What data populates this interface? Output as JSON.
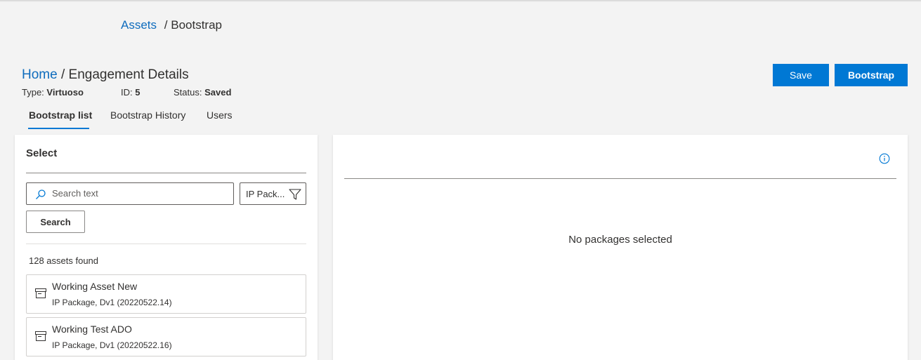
{
  "breadcrumb_top": {
    "link": "Assets",
    "separator": "/",
    "current": "Bootstrap"
  },
  "page": {
    "home_link": "Home",
    "title_rest": "/ Engagement Details"
  },
  "meta": {
    "type_label": "Type:",
    "type_value": "Virtuoso",
    "id_label": "ID:",
    "id_value": "5",
    "status_label": "Status:",
    "status_value": "Saved"
  },
  "actions": {
    "save_label": "Save",
    "bootstrap_label": "Bootstrap"
  },
  "tabs": [
    {
      "label": "Bootstrap list",
      "active": true
    },
    {
      "label": "Bootstrap History",
      "active": false
    },
    {
      "label": "Users",
      "active": false
    }
  ],
  "left_panel": {
    "title": "Select",
    "search_placeholder": "Search text",
    "filter_value": "IP Pack...",
    "search_button": "Search",
    "count_text": "128 assets found",
    "assets": [
      {
        "name": "Working Asset New",
        "detail": "IP Package, Dv1 (20220522.14)"
      },
      {
        "name": "Working Test ADO",
        "detail": "IP Package, Dv1 (20220522.16)"
      }
    ]
  },
  "right_panel": {
    "empty_text": "No packages selected",
    "info_icon": "info-icon"
  },
  "colors": {
    "accent": "#0078d4",
    "link": "#0f6cbd",
    "background": "#f3f3f3"
  }
}
